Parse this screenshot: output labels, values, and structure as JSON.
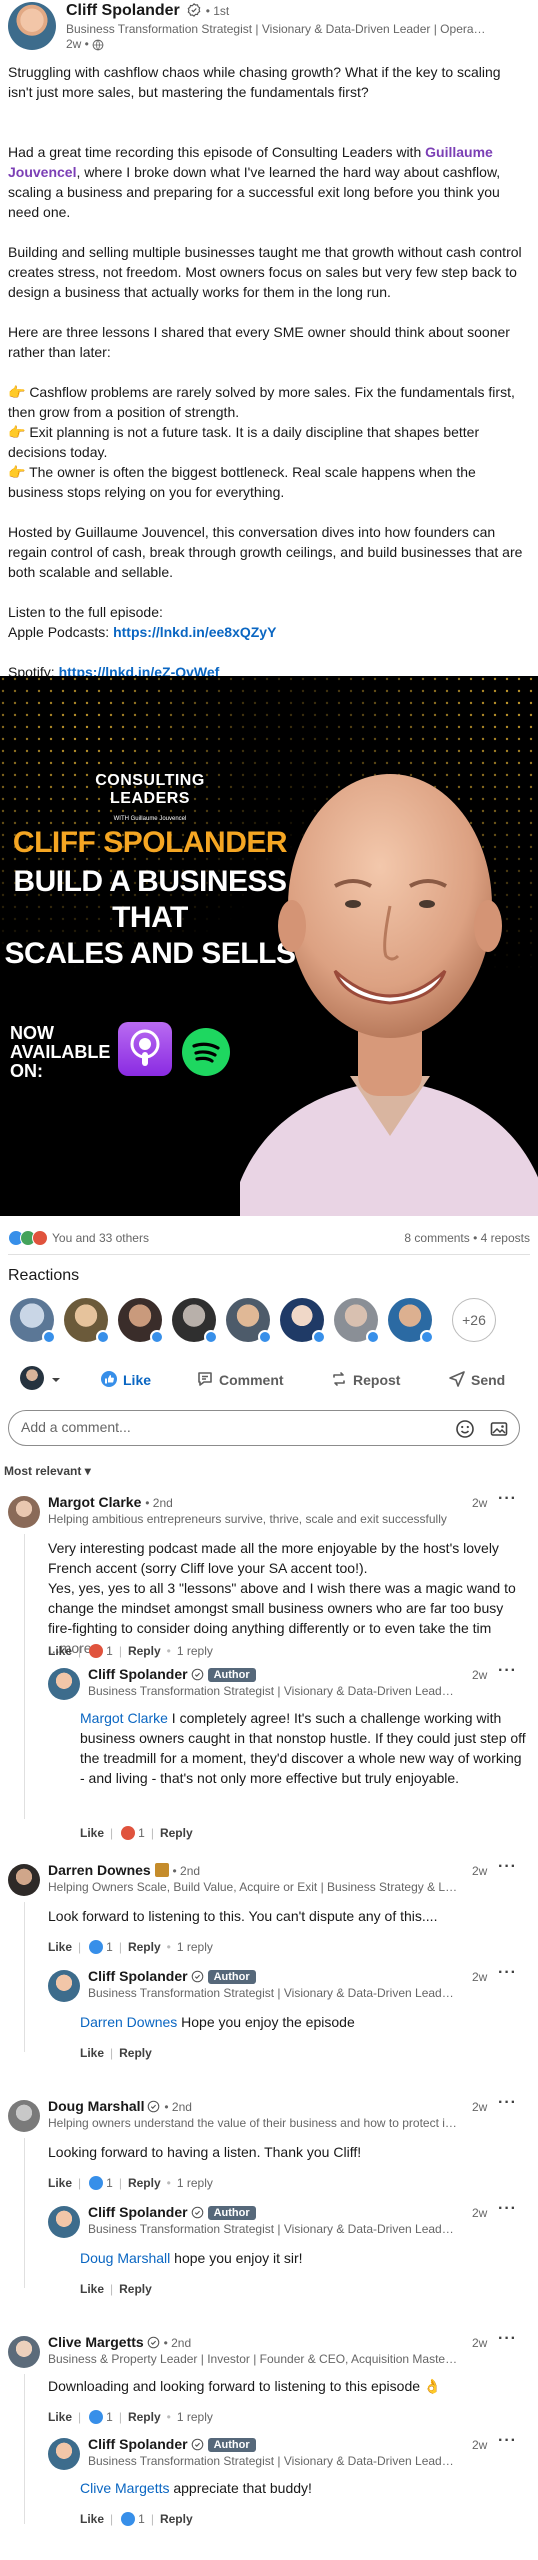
{
  "post": {
    "author_name": "Cliff Spolander",
    "degree": "• 1st",
    "headline": "Business Transformation Strategist | Visionary & Data-Driven Leader | Operati...",
    "time": "2w •",
    "intro": "Struggling with cashflow chaos while chasing growth? What if the key to scaling isn't just more sales, but mastering the fundamentals first?",
    "p2_before": "Had a great time recording this episode of Consulting Leaders with ",
    "p2_link": "Guillaume Jouvencel",
    "p2_after": ", where I broke down what I've learned the hard way about cashflow, scaling a business and preparing for a successful exit long before you think you need one.",
    "p3": "Building and selling multiple businesses taught me that growth without cash control creates stress, not freedom. Most owners focus on sales but very few step back to design a business that actually works for them in the long run.",
    "p4": "Here are three lessons I shared that every SME owner should think about sooner rather than later:",
    "lessons": [
      "👉 Cashflow problems are rarely solved by more sales. Fix the fundamentals first, then grow from a position of strength.",
      "👉 Exit planning is not a future task. It is a daily discipline that shapes better decisions today.",
      "👉 The owner is often the biggest bottleneck. Real scale happens when the business stops relying on you for everything."
    ],
    "p6": "Hosted by Guillaume Jouvencel, this conversation dives into how founders can regain control of cash, break through growth ceilings, and build businesses that are both scalable and sellable.",
    "listen": "Listen to the full episode:",
    "apple_label": "Apple Podcasts: ",
    "apple_link": "https://lnkd.in/ee8xQZyY",
    "spotify_label": "Spotify: ",
    "spotify_link": "https://lnkd.in/eZ-QvWef"
  },
  "hero": {
    "brand": "CONSULTING LEADERS",
    "brand_sub": "WITH Guillaume Jouvencel",
    "name": "CLIFF SPOLANDER",
    "tagline_1": "BUILD A BUSINESS THAT",
    "tagline_2": "SCALES AND SELLS",
    "now": "NOW",
    "available": "AVAILABLE",
    "on": "ON:"
  },
  "social": {
    "likers": "You and 33 others",
    "comments_reposts": "8 comments • 4 reposts",
    "reactions_heading": "Reactions",
    "more_reactors": "+26"
  },
  "actions": {
    "like": "Like",
    "comment": "Comment",
    "repost": "Repost",
    "send": "Send"
  },
  "comment_input": {
    "placeholder": "Add a comment..."
  },
  "sort_label": "Most relevant ▾",
  "comments": [
    {
      "name": "Margot Clarke",
      "degree": "• 2nd",
      "headline": "Helping ambitious entrepreneurs survive, thrive, scale and exit successfully",
      "time": "2w",
      "text_1": "Very interesting podcast made all the more enjoyable by the host's lovely French accent (sorry Cliff love your SA accent too!).",
      "text_2": "Yes, yes, yes to all 3 \"lessons\" above and I wish there was a magic wand to change the mindset amongst small business owners who are far too busy fire-fighting to consider doing anything differently or to even take the tim",
      "more": "...more",
      "like": "Like",
      "like_count": "1",
      "reply": "Reply",
      "replies": "1 reply",
      "reply_item": {
        "name": "Cliff Spolander",
        "badge": "Author",
        "headline": "Business Transformation Strategist | Visionary & Data-Driven Leader | ...",
        "time": "2w",
        "mention": "Margot Clarke",
        "text": " I completely agree! It's such a challenge working with business owners caught in that nonstop hustle. If they could just step off the treadmill for a moment, they'd discover a whole new way of working - and living - that's not only more effective but truly enjoyable.",
        "like": "Like",
        "like_count": "1",
        "reply": "Reply"
      }
    },
    {
      "name": "Darren Downes",
      "degree": "• 2nd",
      "headline": "Helping Owners Scale, Build Value, Acquire or Exit | Business Strategy & Lead...",
      "time": "2w",
      "text_1": "Look forward to listening to this. You can't dispute any of this....",
      "like": "Like",
      "like_count": "1",
      "reply": "Reply",
      "replies": "1 reply",
      "reply_item": {
        "name": "Cliff Spolander",
        "badge": "Author",
        "headline": "Business Transformation Strategist | Visionary & Data-Driven Leader | ...",
        "time": "2w",
        "mention": "Darren Downes",
        "text": " Hope you enjoy the episode",
        "like": "Like",
        "reply": "Reply"
      }
    },
    {
      "name": "Doug Marshall",
      "degree": "• 2nd",
      "headline": "Helping owners understand the value of their business and how to protect it ...",
      "time": "2w",
      "text_1": "Looking forward to having a listen. Thank you Cliff!",
      "like": "Like",
      "like_count": "1",
      "reply": "Reply",
      "replies": "1 reply",
      "reply_item": {
        "name": "Cliff Spolander",
        "badge": "Author",
        "headline": "Business Transformation Strategist | Visionary & Data-Driven Leader | ...",
        "time": "2w",
        "mention": "Doug Marshall",
        "text": " hope you enjoy it sir!",
        "like": "Like",
        "reply": "Reply"
      }
    },
    {
      "name": "Clive Margetts",
      "degree": "• 2nd",
      "headline": "Business & Property Leader | Investor | Founder & CEO, Acquisition Masters |...",
      "time": "2w",
      "text_1": "Downloading and looking forward to listening to this episode 👌",
      "like": "Like",
      "like_count": "1",
      "reply": "Reply",
      "replies": "1 reply",
      "reply_item": {
        "name": "Cliff Spolander",
        "badge": "Author",
        "headline": "Business Transformation Strategist | Visionary & Data-Driven Leader | ...",
        "time": "2w",
        "mention": "Clive Margetts",
        "text": " appreciate that buddy!",
        "like": "Like",
        "like_count": "1",
        "reply": "Reply"
      }
    }
  ],
  "colors": {
    "link": "#0a66c2",
    "mention": "#0a66c2",
    "hero_name": "#f5a623",
    "podcasts": "#8a2be2",
    "spotify": "#1ed760",
    "like_blue": "#378fe9",
    "heart_red": "#e0533d"
  },
  "icons": [
    "verified-icon",
    "globe-icon",
    "like-icon",
    "comment-icon",
    "repost-icon",
    "send-icon",
    "emoji-icon",
    "image-icon",
    "more-icon"
  ]
}
